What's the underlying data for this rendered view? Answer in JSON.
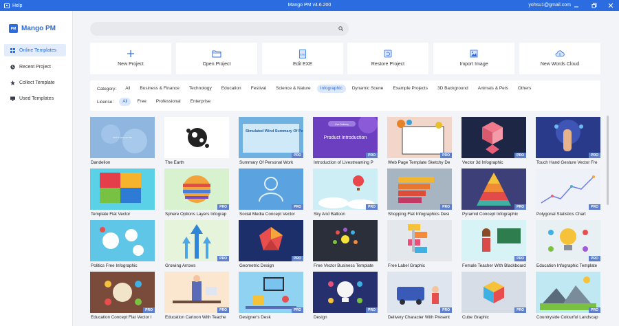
{
  "titlebar": {
    "help": "Help",
    "title": "Mango PM v4.6.200",
    "email": "yohsu1@gmail.com"
  },
  "app": {
    "logo_badge": "PM",
    "logo_name": "Mango PM"
  },
  "sidebar": {
    "items": [
      {
        "label": "Online Templates",
        "icon": "grid-icon",
        "active": true
      },
      {
        "label": "Recent Project",
        "icon": "clock-icon",
        "active": false
      },
      {
        "label": "Collect Template",
        "icon": "star-icon",
        "active": false
      },
      {
        "label": "Used Templates",
        "icon": "monitor-icon",
        "active": false
      }
    ]
  },
  "search": {
    "placeholder": ""
  },
  "actions": [
    {
      "label": "New Project",
      "icon": "plus-icon"
    },
    {
      "label": "Open Project",
      "icon": "folder-icon"
    },
    {
      "label": "Edit EXE",
      "icon": "exe-icon"
    },
    {
      "label": "Restore Project",
      "icon": "restore-icon"
    },
    {
      "label": "Import Image",
      "icon": "image-icon"
    },
    {
      "label": "New Words Cloud",
      "icon": "cloud-icon"
    }
  ],
  "filters": {
    "category_label": "Category:",
    "categories": [
      "All",
      "Business & Finance",
      "Technology",
      "Education",
      "Festival",
      "Science & Nature",
      "Infographic",
      "Dynamic Scene",
      "Example Projects",
      "3D Background",
      "Animals & Pets",
      "Others"
    ],
    "category_selected": "Infographic",
    "license_label": "License:",
    "licenses": [
      "All",
      "Free",
      "Professional",
      "Enterprise"
    ],
    "license_selected": "All"
  },
  "templates": [
    {
      "label": "Dandelion",
      "pro": false,
      "thumb_text": "Click to add your title"
    },
    {
      "label": "The Earth",
      "pro": false
    },
    {
      "label": "Summary Of Personal Work",
      "pro": true,
      "thumb_text": "Simulated Wind Summary Of Personal Work"
    },
    {
      "label": "Introduction of Livestreaming P",
      "pro": true,
      "thumb_text": "Product Introduction",
      "thumb_tag": "Live Delivery"
    },
    {
      "label": "Web Page Template Sketchy De",
      "pro": true
    },
    {
      "label": "Vector 3d Infographic",
      "pro": true
    },
    {
      "label": "Touch Hand Gesture Vector Fre",
      "pro": true
    },
    {
      "label": "Template Flat Vector",
      "pro": false
    },
    {
      "label": "Sphere Options Layers Infograp",
      "pro": true
    },
    {
      "label": "Social Media Concept Vector",
      "pro": true
    },
    {
      "label": "Sky And Balloon",
      "pro": true
    },
    {
      "label": "Shopping Flat Infographics Desi",
      "pro": true
    },
    {
      "label": "Pyramid Concept Infographic",
      "pro": true
    },
    {
      "label": "Polygonal Statistics Chart",
      "pro": true
    },
    {
      "label": "Politics Free Infographic",
      "pro": false
    },
    {
      "label": "Growing Arrows",
      "pro": true
    },
    {
      "label": "Geometric Design",
      "pro": true
    },
    {
      "label": "Free Vector Business Template",
      "pro": false
    },
    {
      "label": "Free Label Graphic",
      "pro": false
    },
    {
      "label": "Female Teacher With Blackboard",
      "pro": true
    },
    {
      "label": "Education Infographic Template",
      "pro": true
    },
    {
      "label": "Education Concept Flat Vector I",
      "pro": true
    },
    {
      "label": "Education Cartoon With Teache",
      "pro": true
    },
    {
      "label": "Designer's Desk",
      "pro": true
    },
    {
      "label": "Design",
      "pro": true
    },
    {
      "label": "Delivery Character With Present",
      "pro": true
    },
    {
      "label": "Cube Graphic",
      "pro": true
    },
    {
      "label": "Countryside Colourful Landscap",
      "pro": true
    }
  ],
  "pro_badge": "PRO",
  "colors": {
    "accent": "#2b6de0",
    "pro_badge": "#5f7fc8"
  }
}
